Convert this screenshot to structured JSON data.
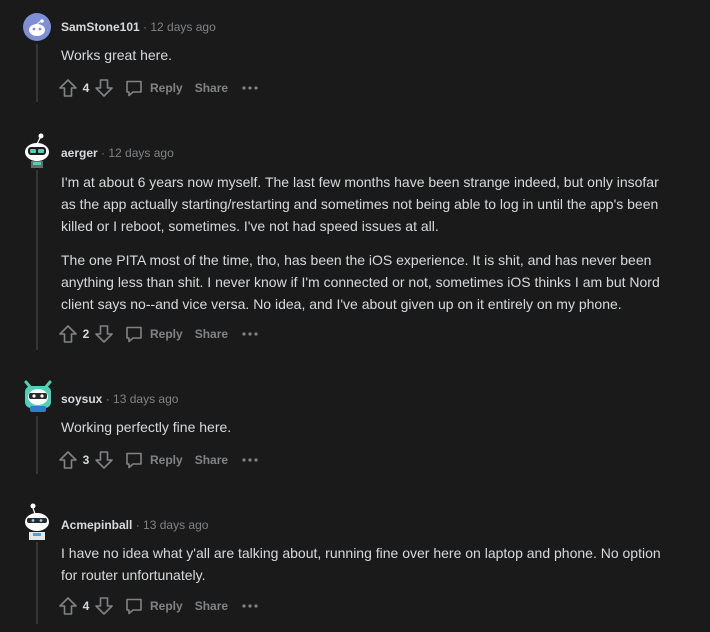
{
  "labels": {
    "reply": "Reply",
    "share": "Share"
  },
  "comments": [
    {
      "author": "SamStone101",
      "age": "· 12 days ago",
      "paragraphs": [
        "Works great here."
      ],
      "votes": "4"
    },
    {
      "author": "aerger",
      "age": "· 12 days ago",
      "paragraphs": [
        "I'm at about 6 years now myself. The last few months have been strange indeed, but only insofar as the app actually starting/restarting and sometimes not being able to log in until the app's been killed or I reboot, sometimes. I've not had speed issues at all.",
        "The one PITA most of the time, tho, has been the iOS experience. It is shit, and has never been anything less than shit. I never know if I'm connected or not, sometimes iOS thinks I am but Nord client says no--and vice versa. No idea, and I've about given up on it entirely on my phone."
      ],
      "votes": "2"
    },
    {
      "author": "soysux",
      "age": "· 13 days ago",
      "paragraphs": [
        "Working perfectly fine here."
      ],
      "votes": "3"
    },
    {
      "author": "Acmepinball",
      "age": "· 13 days ago",
      "paragraphs": [
        "I have no idea what y'all are talking about, running fine over here on laptop and phone. No option for router unfortunately."
      ],
      "votes": "4"
    }
  ]
}
